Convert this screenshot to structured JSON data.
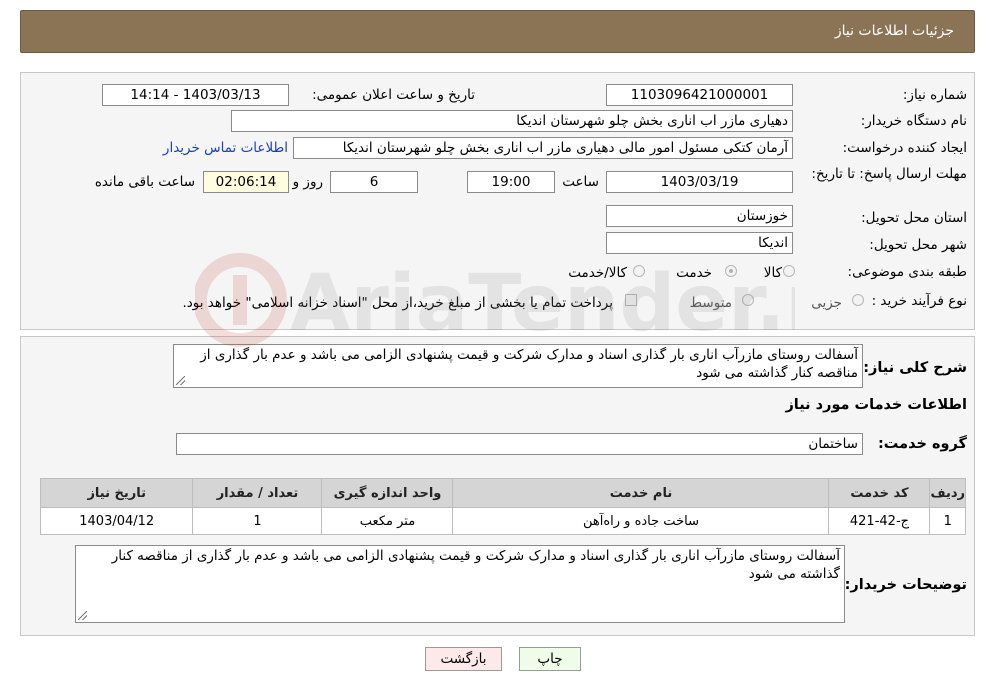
{
  "header": {
    "title": "جزئیات اطلاعات نیاز"
  },
  "form": {
    "need_number": {
      "label": "شماره نیاز:",
      "value": "1103096421000001"
    },
    "announce_datetime": {
      "label": "تاریخ و ساعت اعلان عمومی:",
      "value": "1403/03/13 - 14:14"
    },
    "buyer_org": {
      "label": "نام دستگاه خریدار:",
      "value": "دهیاری مازر اب اناری بخش چلو شهرستان اندیکا"
    },
    "requester": {
      "label": "ایجاد کننده درخواست:",
      "value": "آرمان کتکی مسئول امور مالی دهیاری مازر اب اناری بخش چلو شهرستان اندیکا",
      "contact_link": "اطلاعات تماس خریدار"
    },
    "deadline": {
      "label": "مهلت ارسال پاسخ: تا تاریخ:",
      "date": "1403/03/19",
      "time_label": "ساعت",
      "time": "19:00",
      "days": "6",
      "days_label": "روز و",
      "remaining": "02:06:14",
      "remaining_label": "ساعت باقی مانده"
    },
    "province": {
      "label": "استان محل تحویل:",
      "value": "خوزستان"
    },
    "city": {
      "label": "شهر محل تحویل:",
      "value": "اندیکا"
    },
    "category": {
      "label": "طبقه بندی موضوعی:",
      "options": [
        {
          "label": "کالا",
          "checked": false
        },
        {
          "label": "خدمت",
          "checked": true
        },
        {
          "label": "کالا/خدمت",
          "checked": false
        }
      ]
    },
    "purchase_type": {
      "label": "نوع فرآیند خرید :",
      "options": [
        {
          "label": "جزیی",
          "checked": false
        },
        {
          "label": "متوسط",
          "checked": false
        }
      ],
      "note": "پرداخت تمام یا بخشی از مبلغ خرید،از محل \"اسناد خزانه اسلامی\" خواهد بود."
    }
  },
  "description": {
    "label": "شرح کلی نیاز:",
    "value": "آسفالت روستای مازرآب اناری بار گذاری اسناد و مدارک شرکت و قیمت پشنهادی الزامی می باشد و عدم بار گذاری از مناقصه کنار گذاشته می شود"
  },
  "services": {
    "section_title": "اطلاعات خدمات مورد نیاز",
    "group_label": "گروه خدمت:",
    "group_value": "ساختمان",
    "table": {
      "headers": [
        "ردیف",
        "کد خدمت",
        "نام خدمت",
        "واحد اندازه گیری",
        "تعداد / مقدار",
        "تاریخ نیاز"
      ],
      "rows": [
        [
          "1",
          "ج-42-421",
          "ساخت جاده و راه‌آهن",
          "متر مکعب",
          "1",
          "1403/04/12"
        ]
      ]
    }
  },
  "buyer_notes": {
    "label": "توضیحات خریدار:",
    "value": "آسفالت روستای مازرآب اناری بار گذاری اسناد و مدارک شرکت و قیمت پشنهادی الزامی می باشد و عدم بار گذاری از مناقصه کنار گذاشته می شود"
  },
  "buttons": {
    "print": "چاپ",
    "back": "بازگشت"
  },
  "watermark": {
    "text": "AriaTender.net"
  },
  "colors": {
    "header_bg": "#8b7355",
    "link": "#1a3fbf",
    "back_button_bg": "#fde8ea",
    "print_button_bg": "#eefce8"
  }
}
